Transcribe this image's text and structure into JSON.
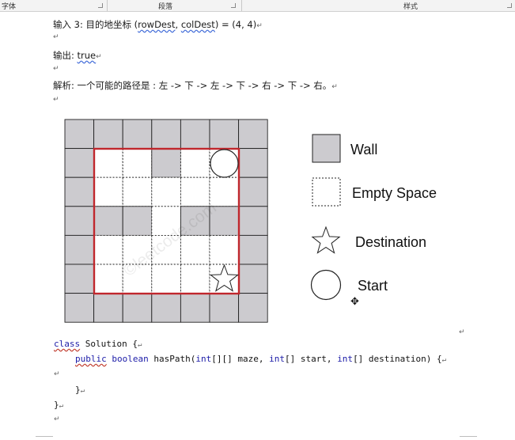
{
  "ribbon": {
    "font_group": "字体",
    "paragraph_group": "段落",
    "styles_group": "样式"
  },
  "paragraph_mark": "↵",
  "document": {
    "input3_prefix": "输入 3: 目的地坐标 (",
    "input3_var1": "rowDest",
    "input3_comma": ", ",
    "input3_var2": "colDest",
    "input3_suffix": ") = (4, 4)",
    "output_label": "输出: ",
    "output_value": "true",
    "explanation": "解析: 一个可能的路径是 : 左 -> 下 -> 左 -> 下 -> 右 -> 下 -> 右。"
  },
  "figure": {
    "watermark": "©leetcode.com",
    "legend": [
      {
        "key": "wall",
        "label": "Wall"
      },
      {
        "key": "empty",
        "label": "Empty Space"
      },
      {
        "key": "destination",
        "label": "Destination"
      },
      {
        "key": "start",
        "label": "Start"
      }
    ],
    "colors": {
      "wall": "#cccbcf",
      "boundary": "#c0272d",
      "grid": "#222222"
    },
    "maze": [
      [
        1,
        1,
        1,
        1,
        1,
        1,
        1
      ],
      [
        1,
        0,
        0,
        1,
        0,
        0,
        1
      ],
      [
        1,
        0,
        0,
        0,
        0,
        0,
        1
      ],
      [
        1,
        1,
        1,
        0,
        1,
        1,
        1
      ],
      [
        1,
        0,
        0,
        0,
        0,
        0,
        1
      ],
      [
        1,
        0,
        0,
        0,
        0,
        0,
        1
      ],
      [
        1,
        1,
        1,
        1,
        1,
        1,
        1
      ]
    ],
    "maze_interior": [
      [
        0,
        0,
        1,
        0,
        0
      ],
      [
        0,
        0,
        0,
        0,
        0
      ],
      [
        1,
        1,
        0,
        1,
        1
      ],
      [
        0,
        0,
        0,
        0,
        0
      ],
      [
        0,
        0,
        0,
        0,
        0
      ]
    ],
    "start": [
      0,
      4
    ],
    "destination": [
      4,
      4
    ]
  },
  "code": {
    "line1_kw": "class",
    "line1_rest": " Solution {",
    "line2_kw1": "public",
    "line2_kw2": "boolean",
    "line2_mid1": " hasPath(",
    "line2_kw3": "int",
    "line2_mid2": "[][] maze, ",
    "line2_kw4": "int",
    "line2_mid3": "[] start, ",
    "line2_kw5": "int",
    "line2_mid4": "[] destination) {",
    "line4": "}",
    "line5": "}"
  }
}
